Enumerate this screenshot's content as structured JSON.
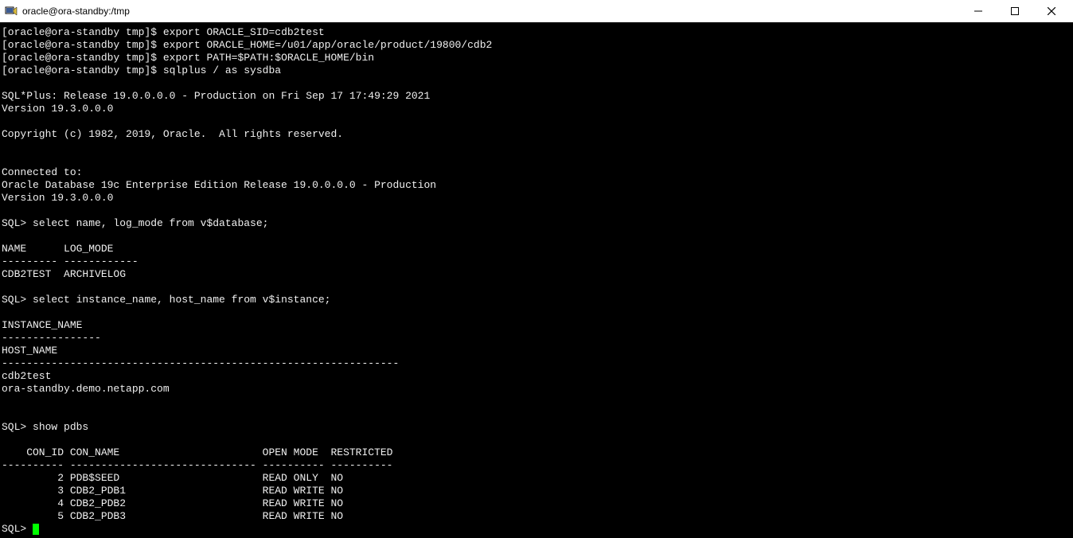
{
  "window": {
    "title": "oracle@ora-standby:/tmp"
  },
  "terminal": {
    "prompts": [
      {
        "prompt": "[oracle@ora-standby tmp]$ ",
        "cmd": "export ORACLE_SID=cdb2test"
      },
      {
        "prompt": "[oracle@ora-standby tmp]$ ",
        "cmd": "export ORACLE_HOME=/u01/app/oracle/product/19800/cdb2"
      },
      {
        "prompt": "[oracle@ora-standby tmp]$ ",
        "cmd": "export PATH=$PATH:$ORACLE_HOME/bin"
      },
      {
        "prompt": "[oracle@ora-standby tmp]$ ",
        "cmd": "sqlplus / as sysdba"
      }
    ],
    "banner": {
      "line1": "SQL*Plus: Release 19.0.0.0.0 - Production on Fri Sep 17 17:49:29 2021",
      "line2": "Version 19.3.0.0.0",
      "copyright": "Copyright (c) 1982, 2019, Oracle.  All rights reserved.",
      "connected1": "Connected to:",
      "connected2": "Oracle Database 19c Enterprise Edition Release 19.0.0.0.0 - Production",
      "connected3": "Version 19.3.0.0.0"
    },
    "query1": {
      "prompt": "SQL> ",
      "sql": "select name, log_mode from v$database;",
      "hdr": "NAME      LOG_MODE",
      "sep": "--------- ------------",
      "row": "CDB2TEST  ARCHIVELOG"
    },
    "query2": {
      "prompt": "SQL> ",
      "sql": "select instance_name, host_name from v$instance;",
      "hdr1": "INSTANCE_NAME",
      "sep1": "----------------",
      "hdr2": "HOST_NAME",
      "sep2": "----------------------------------------------------------------",
      "val1": "cdb2test",
      "val2": "ora-standby.demo.netapp.com"
    },
    "query3": {
      "prompt": "SQL> ",
      "sql": "show pdbs",
      "hdr": "    CON_ID CON_NAME                       OPEN MODE  RESTRICTED",
      "sep": "---------- ------------------------------ ---------- ----------",
      "rows": [
        "         2 PDB$SEED                       READ ONLY  NO",
        "         3 CDB2_PDB1                      READ WRITE NO",
        "         4 CDB2_PDB2                      READ WRITE NO",
        "         5 CDB2_PDB3                      READ WRITE NO"
      ]
    },
    "final_prompt": "SQL> "
  }
}
